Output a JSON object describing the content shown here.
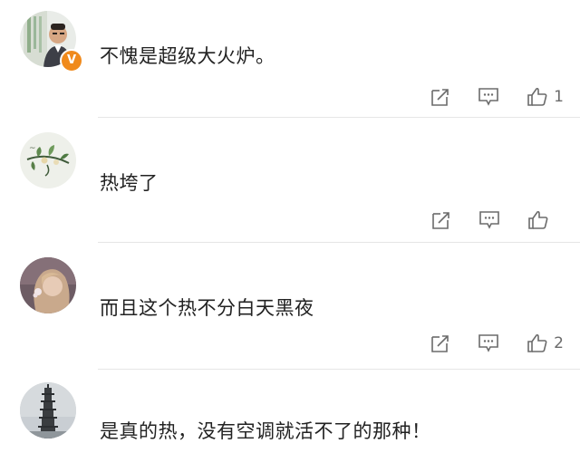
{
  "comments": [
    {
      "text": "不愧是超级大火炉。",
      "likes": "1",
      "verified_badge": "V",
      "avatar_icon": "man-portrait-avatar"
    },
    {
      "text": "热垮了",
      "likes": "",
      "avatar_icon": "plant-drawing-avatar"
    },
    {
      "text": "而且这个热不分白天黑夜",
      "likes": "2",
      "avatar_icon": "woman-portrait-avatar"
    },
    {
      "text": "是真的热，没有空调就活不了的那种！",
      "likes": "",
      "avatar_icon": "pagoda-avatar"
    }
  ],
  "icons": {
    "share": "share-icon",
    "reply": "comment-icon",
    "like": "thumbs-up-icon"
  },
  "colors": {
    "text": "#222222",
    "icon": "#6b6b6b",
    "divider": "#e6e6e6",
    "badge": "#f08a1c"
  }
}
